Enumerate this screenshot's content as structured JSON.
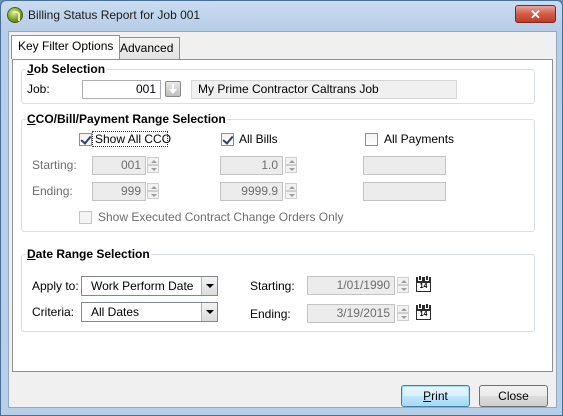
{
  "window": {
    "title": "Billing Status Report for Job 001",
    "close_glyph": "✕"
  },
  "tabs": [
    {
      "label": "Key Filter Options"
    },
    {
      "label": "Advanced"
    }
  ],
  "job_selection": {
    "group_title_first": "J",
    "group_title_rest": "ob Selection",
    "job_label": "Job:",
    "job_value": "001",
    "job_description": "My Prime Contractor Caltrans Job"
  },
  "range_selection": {
    "group_title_first": "C",
    "group_title_rest": "CO/Bill/Payment Range Selection",
    "show_all_cco": {
      "label": "Show All CCO",
      "checked": true
    },
    "all_bills": {
      "label": "All Bills",
      "checked": true
    },
    "all_payments": {
      "label": "All Payments",
      "checked": false
    },
    "starting_label": "Starting:",
    "ending_label": "Ending:",
    "cco_start": "001",
    "cco_end": "999",
    "bill_start": "1.0",
    "bill_end": "9999.9",
    "payment_start": "",
    "payment_end": "",
    "show_executed": {
      "label": "Show Executed Contract Change Orders Only",
      "checked": false
    }
  },
  "date_range": {
    "group_title_first": "D",
    "group_title_rest": "ate Range Selection",
    "apply_to_label": "Apply to:",
    "apply_to_value": "Work Perform Date",
    "criteria_label": "Criteria:",
    "criteria_value": "All Dates",
    "starting_label": "Starting:",
    "starting_value": "1/01/1990",
    "ending_label": "Ending:",
    "ending_value": "3/19/2015",
    "calendar_day": "14"
  },
  "buttons": {
    "print_first": "P",
    "print_rest": "rint",
    "close": "Close"
  }
}
